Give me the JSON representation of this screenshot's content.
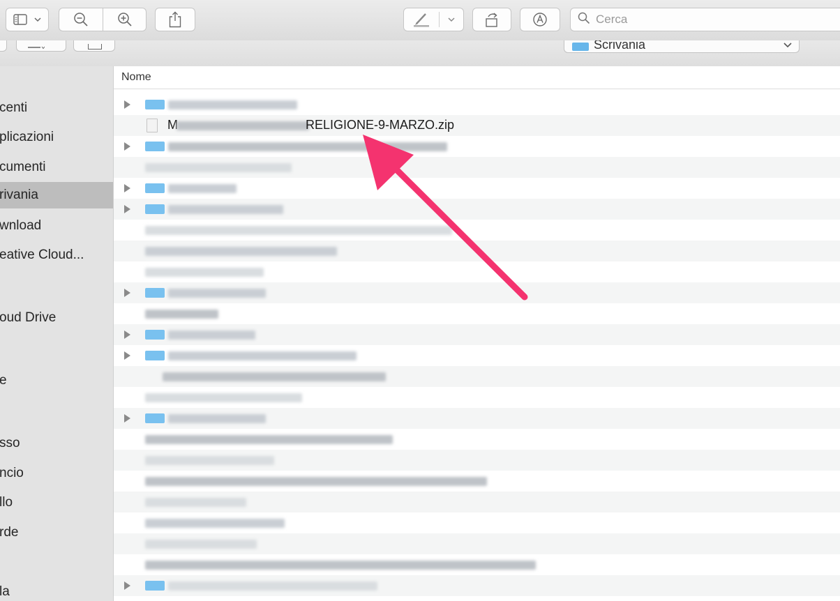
{
  "toolbar": {
    "search_placeholder": "Cerca"
  },
  "location": {
    "current_folder": "Scrivania"
  },
  "sidebar": {
    "items": [
      {
        "label": "centi"
      },
      {
        "label": "plicazioni"
      },
      {
        "label": "cumenti"
      },
      {
        "label": "rivania",
        "selected": true
      },
      {
        "label": "wnload"
      },
      {
        "label": "eative Cloud..."
      },
      {
        "label": "oud Drive"
      },
      {
        "label": "e"
      },
      {
        "label": "sso"
      },
      {
        "label": "ncio"
      },
      {
        "label": "llo"
      },
      {
        "label": "rde"
      },
      {
        "label": "la"
      }
    ]
  },
  "list": {
    "column_header": "Nome",
    "visible_file_suffix": "RELIGIONE-9-MARZO.zip",
    "visible_file_prefix": "M"
  },
  "colors": {
    "annotation_arrow": "#f4336f",
    "folder": "#79c1ef",
    "selected_sidebar": "#bdbdbd"
  }
}
